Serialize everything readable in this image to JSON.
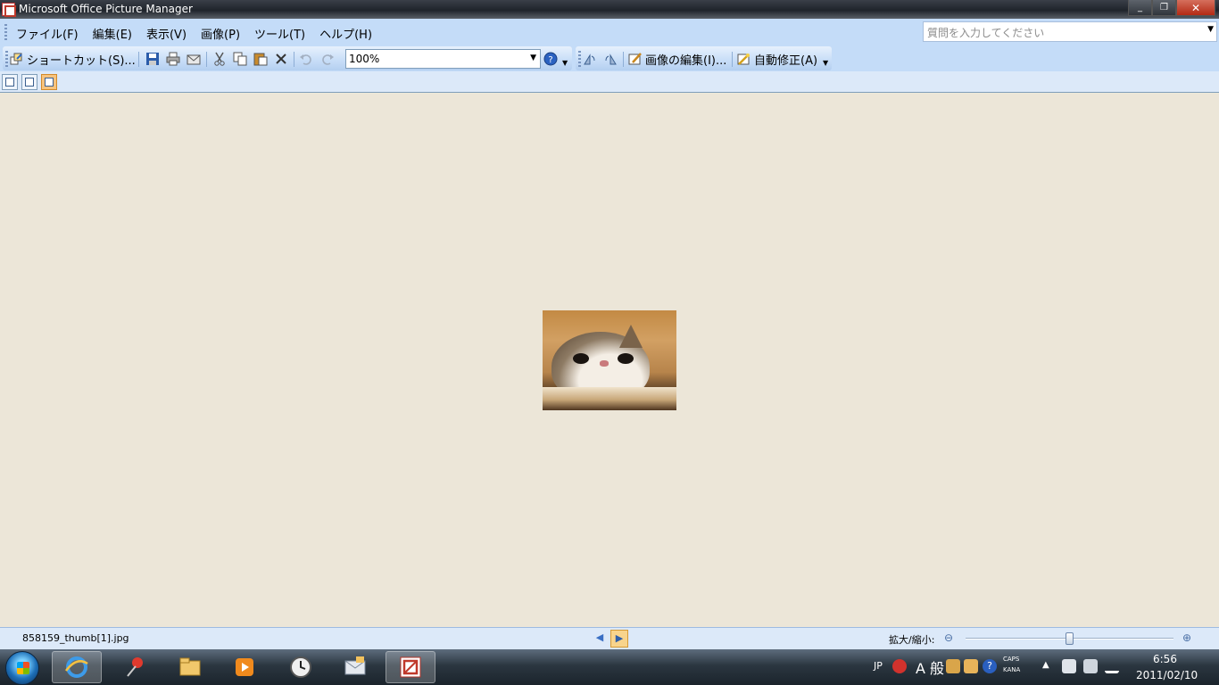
{
  "window": {
    "title": "Microsoft Office Picture Manager",
    "minimize": "_",
    "maximize": "❐",
    "close": "✕"
  },
  "menu": {
    "items": [
      "ファイル(F)",
      "編集(E)",
      "表示(V)",
      "画像(P)",
      "ツール(T)",
      "ヘルプ(H)"
    ],
    "help_placeholder": "質問を入力してください"
  },
  "toolbar": {
    "shortcut_label": "ショートカット(S)...",
    "zoom_value": "100%",
    "edit_picture_label": "画像の編集(I)...",
    "auto_correct_label": "自動修正(A)"
  },
  "status": {
    "filename": "858159_thumb[1].jpg",
    "zoom_label": "拡大/縮小:",
    "zoom_level": 0.5
  },
  "taskbar": {
    "language": "JP",
    "ime_mode": "A 般",
    "caps": "CAPS",
    "kana": "KANA",
    "time": "6:56",
    "date": "2011/02/10"
  },
  "colors": {
    "canvas_bg": "#ece6d8",
    "toolbar_bg": "#c4dcf8",
    "active_view": "#f8c37d"
  }
}
